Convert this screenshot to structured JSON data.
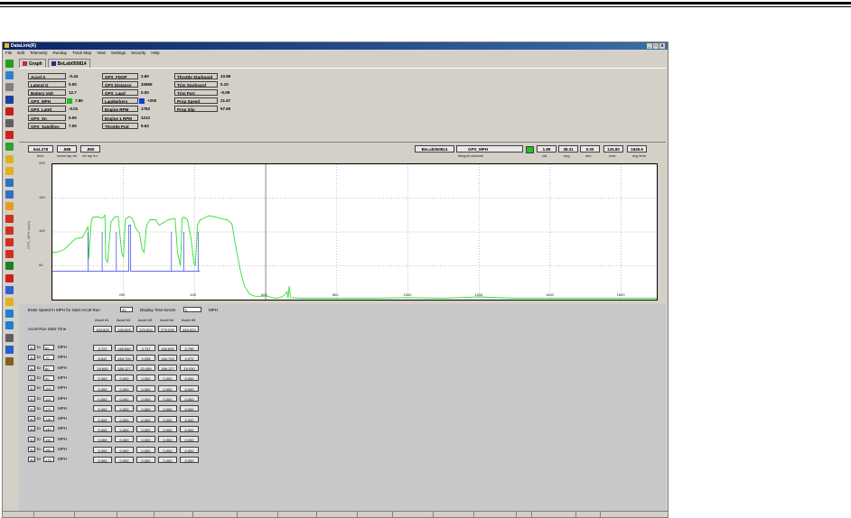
{
  "window": {
    "title": "DataLink(R)",
    "controls": [
      "_",
      "□",
      "x"
    ]
  },
  "menu": [
    "File",
    "Edit",
    "Telemetry",
    "Runday",
    "Track Map",
    "View",
    "Settings",
    "Security",
    "Help"
  ],
  "toolbar_icons": [
    "green-square-icon",
    "arrow-icon",
    "gear-icon",
    "save-icon",
    "flag-icon",
    "print-icon",
    "x-icon",
    "chart-icon",
    "map-icon",
    "folder-icon",
    "bar-icon",
    "cursor-icon",
    "align-icon",
    "left-arrow-icon",
    "right-arrow-icon",
    "up-arrow-icon",
    "down-arrow-icon",
    "split-icon",
    "marker-icon",
    "zoom-icon",
    "tag-icon",
    "compare-icon",
    "compare2-icon",
    "settings-icon",
    "help-icon",
    "scale-icon"
  ],
  "tabs": [
    {
      "label": "Graph"
    },
    {
      "label": "BeLab050814"
    }
  ],
  "channels": {
    "col1": [
      {
        "label": "Accel X",
        "value": "-0.44"
      },
      {
        "label": "Lateral G",
        "value": "0.00"
      },
      {
        "label": "Battery Volt",
        "value": "12.7"
      },
      {
        "label": "GPS_MPH",
        "value": "7.80",
        "swatch": "#22c022"
      },
      {
        "label": "GPS_Lattd",
        "value": "-0.01"
      },
      {
        "label": "GPS_Sn",
        "value": "0.00"
      },
      {
        "label": "GPS_Satellites",
        "value": "7.00"
      }
    ],
    "col2": [
      {
        "label": "GPS_FDOP",
        "value": "2.60"
      },
      {
        "label": "GPS Distance",
        "value": "32865"
      },
      {
        "label": "GPS_Lapd",
        "value": "0.00"
      },
      {
        "label": "LapMarkers",
        "value": "+200",
        "swatch": "#1040e0"
      },
      {
        "label": "Engine RPM",
        "value": "1762"
      },
      {
        "label": "Engine 1 RPM",
        "value": "1212"
      },
      {
        "label": "Throttle Pod",
        "value": "9.63"
      }
    ],
    "col3": [
      {
        "label": "Throttle Starboard",
        "value": "10.86"
      },
      {
        "label": "Trim Starboard",
        "value": "0.10"
      },
      {
        "label": "Trim Port",
        "value": "-0.09"
      },
      {
        "label": "Prop Speed",
        "value": "21.67"
      },
      {
        "label": "Prop Slip",
        "value": "57.60"
      }
    ]
  },
  "chart_header": {
    "time": "644.278",
    "time_cap": "time",
    "lap_tm": ".888",
    "lap_tm_cap": "mean lap tm",
    "ref_lap": ".890",
    "ref_lap_cap": "ref lap tm",
    "file": "BeLab050814",
    "channel": "GPS_MPH",
    "channel_cap": "file/grid channel",
    "swatch": "#22c022",
    "stats": [
      {
        "value": "1.89",
        "cap": "val"
      },
      {
        "value": "38.31",
        "cap": "avg"
      },
      {
        "value": "0.00",
        "cap": "min"
      },
      {
        "value": "125.80",
        "cap": "max"
      },
      {
        "value": "1849.6",
        "cap": "avg time"
      }
    ]
  },
  "chart_data": {
    "type": "line",
    "ylabel": "GPS_MPH (mph)",
    "xlim": [
      0,
      1700
    ],
    "ylim": [
      0,
      200
    ],
    "yticks": [
      50,
      100,
      150,
      200
    ],
    "xticks": [
      200,
      400,
      600,
      800,
      1000,
      1200,
      1400,
      1600
    ],
    "cursor_x": 600,
    "series": [
      {
        "color": "#33dd33",
        "x": [
          0,
          10,
          25,
          35,
          45,
          55,
          65,
          85,
          100,
          102,
          110,
          115,
          130,
          140,
          148,
          150,
          155,
          165,
          175,
          185,
          195,
          200,
          205,
          215,
          225,
          235,
          245,
          252,
          258,
          265,
          275,
          290,
          300,
          310,
          325,
          345,
          352,
          360,
          365,
          370,
          380,
          390,
          398,
          402,
          408,
          416,
          425,
          440,
          460,
          480,
          492,
          505,
          515,
          528,
          540,
          555,
          570,
          580,
          595,
          605,
          620,
          630,
          640,
          648,
          655,
          660,
          663,
          666,
          670,
          700,
          800,
          900,
          1000,
          1100,
          1200,
          1300,
          1400,
          1500,
          1600,
          1700
        ],
        "y": [
          70,
          70,
          72,
          75,
          80,
          85,
          90,
          92,
          108,
          60,
          118,
          122,
          122,
          120,
          125,
          60,
          55,
          115,
          122,
          123,
          70,
          62,
          118,
          123,
          120,
          105,
          98,
          75,
          70,
          110,
          118,
          118,
          110,
          113,
          118,
          120,
          70,
          50,
          120,
          122,
          118,
          90,
          55,
          50,
          110,
          118,
          120,
          124,
          122,
          119,
          118,
          112,
          80,
          45,
          20,
          8,
          5,
          5,
          5,
          5,
          3,
          2,
          3,
          5,
          8,
          12,
          2,
          20,
          3,
          2,
          2,
          2,
          3,
          2,
          4,
          2,
          2,
          2,
          2,
          2
        ]
      },
      {
        "color": "#3344ee",
        "x": [
          0,
          100,
          100,
          100,
          140,
          140,
          140,
          180,
          180,
          180,
          215,
          215,
          220,
          220,
          335,
          335,
          335,
          370,
          370,
          370,
          410,
          410,
          410,
          415
        ],
        "y": [
          42,
          42,
          100,
          42,
          42,
          100,
          42,
          42,
          100,
          42,
          42,
          110,
          110,
          42,
          42,
          100,
          42,
          42,
          100,
          42,
          42,
          100,
          42,
          42
        ]
      }
    ]
  },
  "lower": {
    "speed_label": "Enter Speed in MPH for Start Accel Run",
    "speed_value": "30",
    "display_label": "Display Time Errors",
    "display_value": "0",
    "display_unit": "MPH",
    "accel_headers": [
      "Accel #1",
      "Accel #2",
      "Accel #3",
      "Accel #4",
      "Accel #5"
    ],
    "start_time_label": "Accel Run Start Time",
    "start_times": [
      "183.829",
      "183.693",
      "220.824",
      "279.039",
      "464.924"
    ],
    "unit": "MPH",
    "rows": [
      {
        "from": "30",
        "to": "60",
        "vals": [
          "3.722",
          "185.680",
          "3.747",
          "184.800",
          "3.796"
        ]
      },
      {
        "from": "30",
        "to": "70",
        "vals": [
          "8.642",
          "184.700",
          "4.036",
          "184.700",
          "4.072"
        ]
      },
      {
        "from": "30",
        "to": "80",
        "vals": [
          "19.600",
          "186.127",
          "20.459",
          "186.127",
          "19.030"
        ]
      },
      {
        "from": "30",
        "to": "90",
        "vals": [
          "0.000",
          "0.000",
          "0.000",
          "0.000",
          "0.000"
        ]
      },
      {
        "from": "30",
        "to": "100",
        "vals": [
          "0.000",
          "0.000",
          "0.000",
          "0.000",
          "0.000"
        ]
      },
      {
        "from": "30",
        "to": "110",
        "vals": [
          "0.000",
          "0.000",
          "0.000",
          "0.000",
          "0.000"
        ]
      },
      {
        "from": "30",
        "to": "120",
        "vals": [
          "0.000",
          "0.000",
          "0.000",
          "0.000",
          "0.000"
        ]
      },
      {
        "from": "30",
        "to": "130",
        "vals": [
          "0.000",
          "0.000",
          "0.000",
          "0.000",
          "0.000"
        ]
      },
      {
        "from": "30",
        "to": "140",
        "vals": [
          "0.000",
          "0.000",
          "0.000",
          "0.000",
          "0.000"
        ]
      },
      {
        "from": "30",
        "to": "150",
        "vals": [
          "0.000",
          "0.000",
          "0.000",
          "0.000",
          "0.000"
        ]
      },
      {
        "from": "30",
        "to": "160",
        "vals": [
          "0.000",
          "0.000",
          "0.000",
          "0.000",
          "0.000"
        ]
      },
      {
        "from": "30",
        "to": "170",
        "vals": [
          "0.000",
          "0.000",
          "0.000",
          "0.000",
          "0.000"
        ]
      }
    ]
  }
}
